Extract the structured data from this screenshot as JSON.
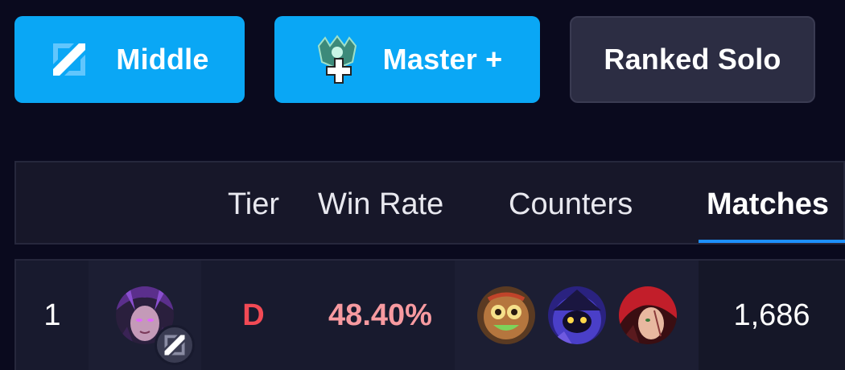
{
  "filters": {
    "role": {
      "label": "Middle",
      "icon": "middle-lane-icon"
    },
    "rank": {
      "label": "Master +",
      "icon": "master-plus-rank-icon"
    },
    "queue": {
      "label": "Ranked Solo"
    }
  },
  "table": {
    "headers": {
      "tier": "Tier",
      "win_rate": "Win Rate",
      "counters": "Counters",
      "matches": "Matches"
    },
    "sorted_by": "Matches",
    "rows": [
      {
        "rank": "1",
        "champion_icon": "champion-portrait-icon",
        "role_icon": "middle-lane-icon",
        "tier": "D",
        "win_rate": "48.40%",
        "counters": [
          "counter-champion-icon-1",
          "counter-champion-icon-2",
          "counter-champion-icon-3"
        ],
        "matches": "1,686"
      }
    ]
  },
  "colors": {
    "background": "#0a0a1e",
    "accent_button": "#0aa7f5",
    "tier_d": "#f24a55",
    "win_rate_low": "#f79aa0",
    "sort_underline": "#1e90ff"
  }
}
